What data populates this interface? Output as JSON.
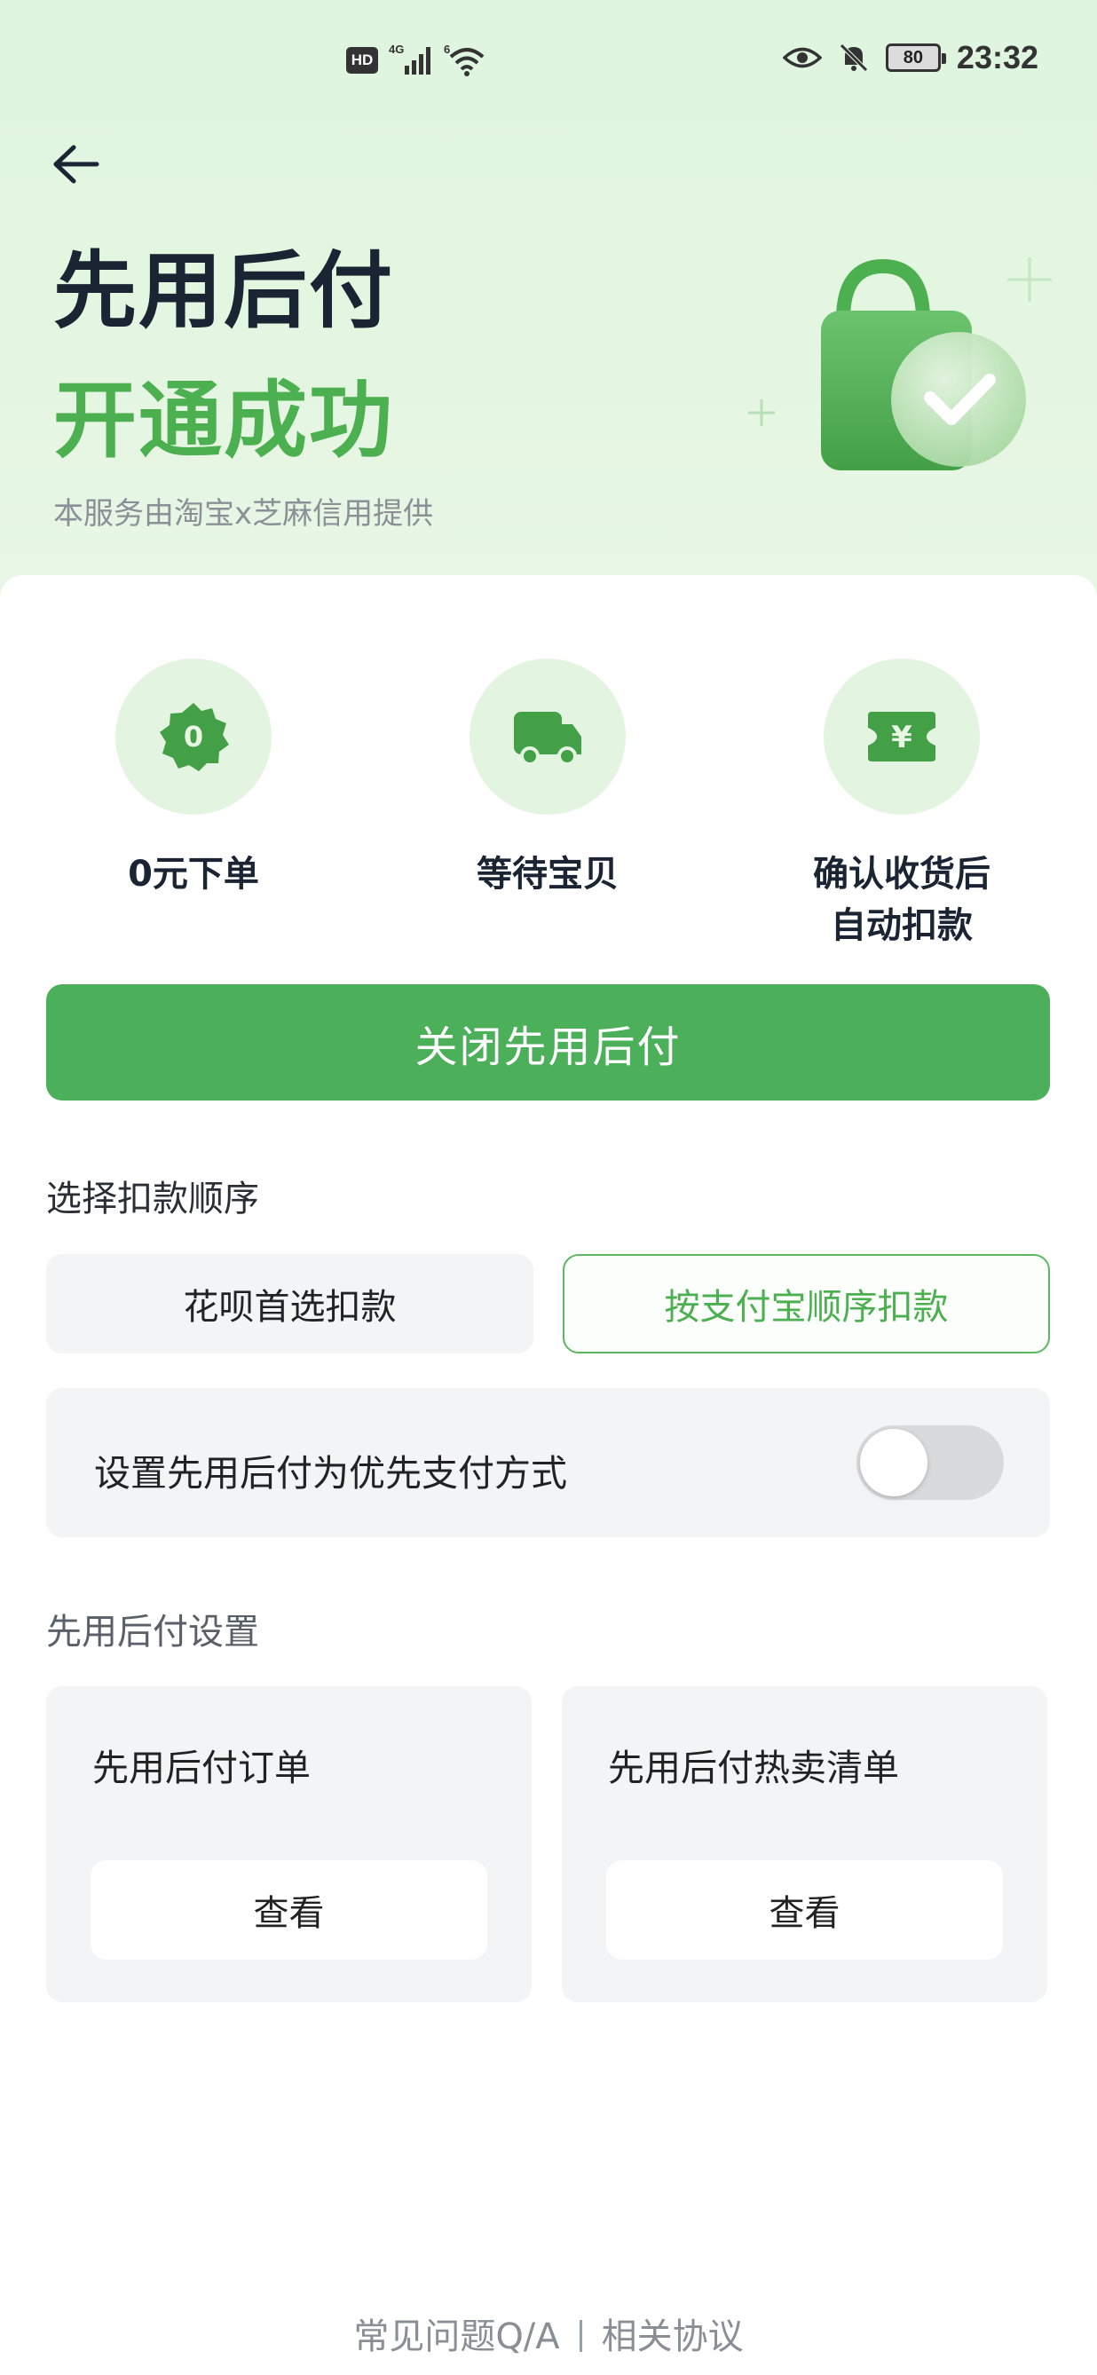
{
  "status_bar": {
    "hd_label": "HD",
    "network_label": "4G",
    "wifi_label": "6",
    "battery_level": "80",
    "time": "23:32"
  },
  "hero": {
    "title": "先用后付",
    "subtitle": "开通成功",
    "provider": "本服务由淘宝x芝麻信用提供",
    "accent_color": "#4caf50"
  },
  "features": [
    {
      "icon": "zero-badge-icon",
      "icon_text": "0",
      "label": "0元下单"
    },
    {
      "icon": "delivery-truck-icon",
      "label": "等待宝贝"
    },
    {
      "icon": "yuan-ticket-icon",
      "icon_text": "¥",
      "label": "确认收货后\n自动扣款"
    }
  ],
  "close_button": {
    "label": "关闭先用后付"
  },
  "deduction_order": {
    "title": "选择扣款顺序",
    "options": [
      {
        "label": "花呗首选扣款",
        "selected": false
      },
      {
        "label": "按支付宝顺序扣款",
        "selected": true
      }
    ]
  },
  "preferred_payment": {
    "label": "设置先用后付为优先支付方式",
    "enabled": false
  },
  "settings": {
    "title": "先用后付设置",
    "cards": [
      {
        "title": "先用后付订单",
        "button": "查看"
      },
      {
        "title": "先用后付热卖清单",
        "button": "查看"
      }
    ]
  },
  "footer": {
    "faq": "常见问题Q/A",
    "agreement": "相关协议"
  }
}
